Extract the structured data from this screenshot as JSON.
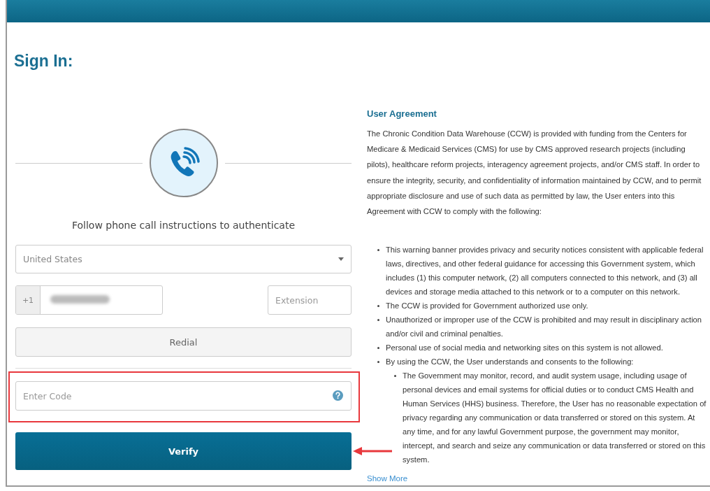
{
  "title": "Sign In:",
  "auth": {
    "instruction": "Follow phone call instructions to authenticate",
    "country": {
      "value": "United States"
    },
    "phone": {
      "prefix": "+1",
      "redacted": true
    },
    "extension": {
      "placeholder": "Extension"
    },
    "redial_button": "Redial",
    "code": {
      "placeholder": "Enter Code"
    },
    "verify_button": "Verify"
  },
  "agreement": {
    "title": "User Agreement",
    "intro": "The Chronic Condition Data Warehouse (CCW) is provided with funding from the Centers for Medicare & Medicaid Services (CMS) for use by CMS approved research projects (including pilots), healthcare reform projects, interagency agreement projects, and/or CMS staff. In order to ensure the integrity, security, and confidentiality of information maintained by CCW, and to permit appropriate disclosure and use of such data as permitted by law, the User enters into this Agreement with CCW to comply with the following:",
    "items": [
      {
        "text": "This warning banner provides privacy and security notices consistent with applicable federal laws, directives, and other federal guidance for accessing this Government system, which includes (1) this computer network, (2) all computers connected to this network, and (3) all devices and storage media attached to this network or to a computer on this network."
      },
      {
        "text": "The CCW is provided for Government authorized use only."
      },
      {
        "text": "Unauthorized or improper use of the CCW is prohibited and may result in disciplinary action and/or civil and criminal penalties."
      },
      {
        "text": "Personal use of social media and networking sites on this system is not allowed."
      },
      {
        "text": "By using the CCW, the User understands and consents to the following:",
        "children": [
          {
            "text": "The Government may monitor, record, and audit system usage, including usage of personal devices and email systems for official duties or to conduct CMS Health and Human Services (HHS) business. Therefore, the User has no reasonable expectation of privacy regarding any communication or data transferred or stored on this system. At any time, and for any lawful Government purpose, the government may monitor, intercept, and search and seize any communication or data transferred or stored on this system."
          }
        ]
      }
    ],
    "show_more": "Show More"
  }
}
